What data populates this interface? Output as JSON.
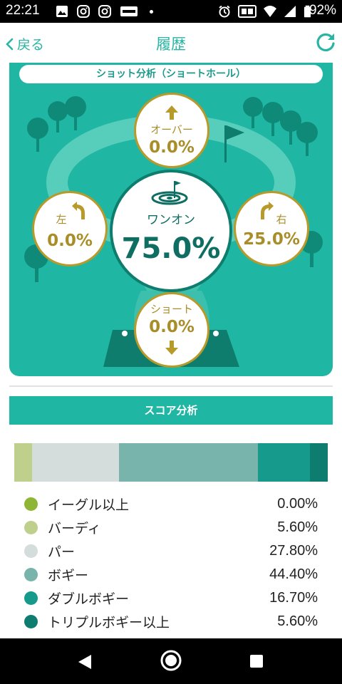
{
  "status_bar": {
    "time": "22:21",
    "battery": "92%",
    "left_icons": [
      "image-icon",
      "instagram-icon",
      "instagram-icon",
      "app-icon",
      "dot-icon"
    ],
    "right_icons": [
      "alarm-icon",
      "cast-icon",
      "wifi-icon",
      "signal-icon",
      "battery-icon"
    ]
  },
  "header": {
    "back_label": "戻る",
    "title": "履歴",
    "refresh_icon": "refresh-icon",
    "accent": "#2ab5a2"
  },
  "shot_analysis": {
    "title": "ショット分析（ショートホール）",
    "center": {
      "label": "ワンオン",
      "value": "75.0%"
    },
    "over": {
      "label": "オーバー",
      "value": "0.0%"
    },
    "left": {
      "label": "左",
      "value": "0.0%"
    },
    "right": {
      "label": "右",
      "value": "25.0%"
    },
    "short": {
      "label": "ショート",
      "value": "0.0%"
    },
    "colors": {
      "card": "#1fb7a3",
      "gold": "#a98d28",
      "dark": "#0f6e62"
    }
  },
  "score_analysis": {
    "title": "スコア分析",
    "items": [
      {
        "label": "イーグル以上",
        "value": "0.00%",
        "fraction": 0.0,
        "color": "#8fb535"
      },
      {
        "label": "バーディ",
        "value": "5.60%",
        "fraction": 0.056,
        "color": "#bfd08c"
      },
      {
        "label": "パー",
        "value": "27.80%",
        "fraction": 0.278,
        "color": "#d4dcdc"
      },
      {
        "label": "ボギー",
        "value": "44.40%",
        "fraction": 0.444,
        "color": "#78b3ac"
      },
      {
        "label": "ダブルボギー",
        "value": "16.70%",
        "fraction": 0.167,
        "color": "#159a8b"
      },
      {
        "label": "トリプルボギー以上",
        "value": "5.60%",
        "fraction": 0.056,
        "color": "#0e7d70"
      }
    ]
  },
  "nav_bar": {
    "buttons": [
      "back-icon",
      "home-icon",
      "recents-icon"
    ]
  }
}
